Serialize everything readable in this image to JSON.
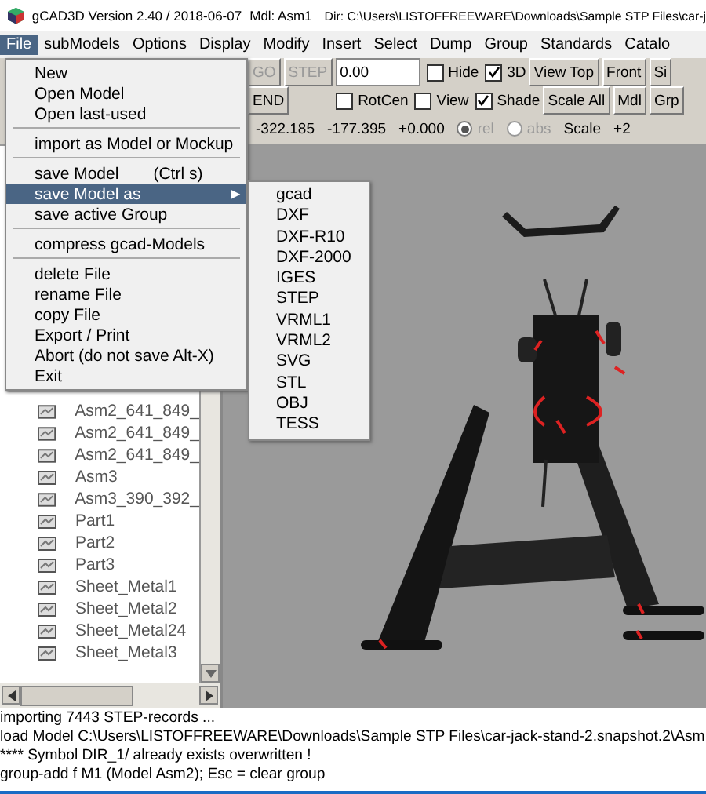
{
  "window": {
    "title": "gCAD3D Version 2.40 / 2018-06-07",
    "model": "Mdl: Asm1",
    "directory": "Dir: C:\\Users\\LISTOFFREEWARE\\Downloads\\Sample STP Files\\car-j"
  },
  "menubar": [
    {
      "label": "File",
      "selected": true
    },
    {
      "label": "subModels",
      "selected": false
    },
    {
      "label": "Options",
      "selected": false
    },
    {
      "label": "Display",
      "selected": false
    },
    {
      "label": "Modify",
      "selected": false
    },
    {
      "label": "Insert",
      "selected": false
    },
    {
      "label": "Select",
      "selected": false
    },
    {
      "label": "Dump",
      "selected": false
    },
    {
      "label": "Group",
      "selected": false
    },
    {
      "label": "Standards",
      "selected": false
    },
    {
      "label": "Catalo",
      "selected": false
    }
  ],
  "toolbar": {
    "rows": [
      {
        "controls": [
          {
            "kind": "button",
            "label": "GO",
            "disabled": true
          },
          {
            "kind": "button",
            "label": "STEP",
            "disabled": true
          },
          {
            "kind": "field",
            "value": "0.00"
          },
          {
            "kind": "checkbox",
            "label": "Hide",
            "checked": false
          },
          {
            "kind": "checkbox",
            "label": "3D",
            "checked": true
          },
          {
            "kind": "button",
            "label": "View Top",
            "disabled": false
          },
          {
            "kind": "button",
            "label": "Front",
            "disabled": false
          },
          {
            "kind": "button",
            "label": "Si",
            "disabled": false
          }
        ]
      },
      {
        "controls": [
          {
            "kind": "button",
            "label": "END",
            "disabled": false
          },
          {
            "kind": "checkbox",
            "label": "RotCen",
            "checked": false
          },
          {
            "kind": "checkbox",
            "label": "View",
            "checked": false
          },
          {
            "kind": "checkbox",
            "label": "Shade",
            "checked": true
          },
          {
            "kind": "button",
            "label": "Scale All",
            "disabled": false
          },
          {
            "kind": "button",
            "label": "Mdl",
            "disabled": false
          },
          {
            "kind": "button",
            "label": "Grp",
            "disabled": false
          }
        ]
      },
      {
        "controls": [
          {
            "kind": "text",
            "label": "-322.185"
          },
          {
            "kind": "text",
            "label": "-177.395"
          },
          {
            "kind": "text",
            "label": "+0.000"
          },
          {
            "kind": "radio",
            "label": "rel",
            "selected": true
          },
          {
            "kind": "radio",
            "label": "abs",
            "selected": false
          },
          {
            "kind": "text",
            "label": "Scale"
          },
          {
            "kind": "text",
            "label": "+2"
          }
        ]
      }
    ]
  },
  "file_menu": [
    {
      "kind": "item",
      "label": "New",
      "selected": false
    },
    {
      "kind": "item",
      "label": "Open Model",
      "selected": false
    },
    {
      "kind": "item",
      "label": "Open last-used",
      "selected": false
    },
    {
      "kind": "separator"
    },
    {
      "kind": "item",
      "label": "import as Model or Mockup",
      "selected": false
    },
    {
      "kind": "separator"
    },
    {
      "kind": "item",
      "label": "save Model",
      "shortcut": "(Ctrl s)",
      "selected": false
    },
    {
      "kind": "submenu",
      "label": "save Model as",
      "selected": true,
      "arrow": "▶"
    },
    {
      "kind": "item",
      "label": "save active Group",
      "selected": false
    },
    {
      "kind": "separator"
    },
    {
      "kind": "item",
      "label": "compress gcad-Models",
      "selected": false
    },
    {
      "kind": "separator"
    },
    {
      "kind": "item",
      "label": "delete File",
      "selected": false
    },
    {
      "kind": "item",
      "label": "rename File",
      "selected": false
    },
    {
      "kind": "item",
      "label": "copy File",
      "selected": false
    },
    {
      "kind": "item",
      "label": "Export / Print",
      "selected": false
    },
    {
      "kind": "item",
      "label": "Abort (do not save  Alt-X)",
      "selected": false
    },
    {
      "kind": "item",
      "label": "Exit",
      "selected": false
    }
  ],
  "save_as_menu": [
    "gcad",
    "DXF",
    "DXF-R10",
    "DXF-2000",
    "IGES",
    "STEP",
    "VRML1",
    "VRML2",
    "SVG",
    "STL",
    "OBJ",
    "TESS"
  ],
  "tree": {
    "items": [
      "Asm2_641_849_",
      "Asm2_641_849_",
      "Asm2_641_849_",
      "Asm3",
      "Asm3_390_392_",
      "Part1",
      "Part2",
      "Part3",
      "Sheet_Metal1",
      "Sheet_Metal2",
      "Sheet_Metal24",
      "Sheet_Metal3"
    ]
  },
  "messages": [
    "importing 7443 STEP-records ...",
    "load Model C:\\Users\\LISTOFFREEWARE\\Downloads\\Sample STP Files\\car-jack-stand-2.snapshot.2\\Asm",
    "**** Symbol DIR_1/ already exists  overwritten !",
    "group-add f M1 (Model Asm2); Esc = clear group"
  ]
}
